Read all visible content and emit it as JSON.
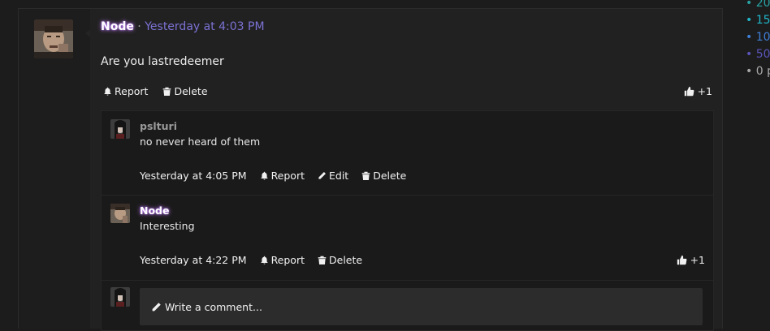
{
  "post": {
    "author": "Node",
    "separator": " · ",
    "time": "Yesterday at 4:03 PM",
    "body": "Are you lastredeemer",
    "actions": {
      "report": "Report",
      "delete": "Delete"
    },
    "likes": "+1"
  },
  "comments": [
    {
      "author": "pslturi",
      "text": "no never heard of them",
      "time": "Yesterday at 4:05 PM",
      "actions": {
        "report": "Report",
        "edit": "Edit",
        "delete": "Delete"
      }
    },
    {
      "author": "Node",
      "text": "Interesting",
      "time": "Yesterday at 4:22 PM",
      "actions": {
        "report": "Report",
        "delete": "Delete"
      },
      "likes": "+1"
    }
  ],
  "write_comment": {
    "placeholder": "Write a comment..."
  },
  "right_list": [
    {
      "text": "• 20",
      "color": "#29a3a3"
    },
    {
      "text": "• 15",
      "color": "#1fb5c9"
    },
    {
      "text": "• 10",
      "color": "#3f7fd6"
    },
    {
      "text": "• 50",
      "color": "#5a55b8"
    },
    {
      "text": "• 0 p",
      "color": "#a8a8a8"
    }
  ],
  "colors": {
    "accent_link": "#7b72d4",
    "author_glow": "#c07cff"
  }
}
